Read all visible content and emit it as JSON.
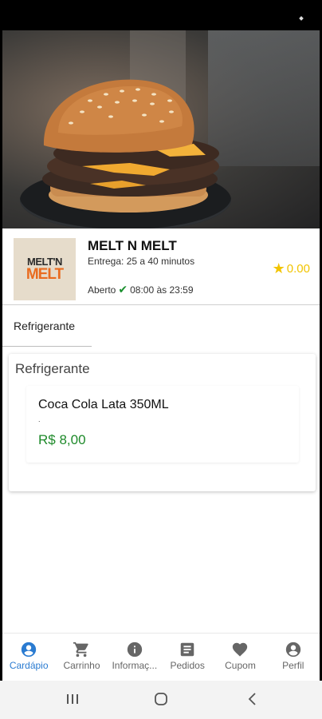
{
  "restaurant": {
    "name": "MELT N MELT",
    "logo_line1": "MELT'N",
    "logo_line2": "MELT",
    "delivery": "Entrega: 25 a 40 minutos",
    "status": "Aberto",
    "hours": "08:00 às 23:59",
    "rating": "0.00"
  },
  "tabs": [
    {
      "label": "Refrigerante"
    }
  ],
  "category": {
    "title": "Refrigerante",
    "products": [
      {
        "name": "Coca Cola Lata 350ML",
        "description": ".",
        "price": "R$ 8,00"
      }
    ]
  },
  "bottom_nav": [
    {
      "label": "Cardápio",
      "icon": "account-circle-icon",
      "active": true
    },
    {
      "label": "Carrinho",
      "icon": "cart-icon",
      "active": false
    },
    {
      "label": "Informaç...",
      "icon": "info-icon",
      "active": false
    },
    {
      "label": "Pedidos",
      "icon": "orders-icon",
      "active": false
    },
    {
      "label": "Cupom",
      "icon": "heart-icon",
      "active": false
    },
    {
      "label": "Perfil",
      "icon": "person-circle-icon",
      "active": false
    }
  ],
  "colors": {
    "accent": "#2a7bd1",
    "price": "#1e8a2a",
    "rating": "#f2c400",
    "open": "#1a8f2e"
  }
}
